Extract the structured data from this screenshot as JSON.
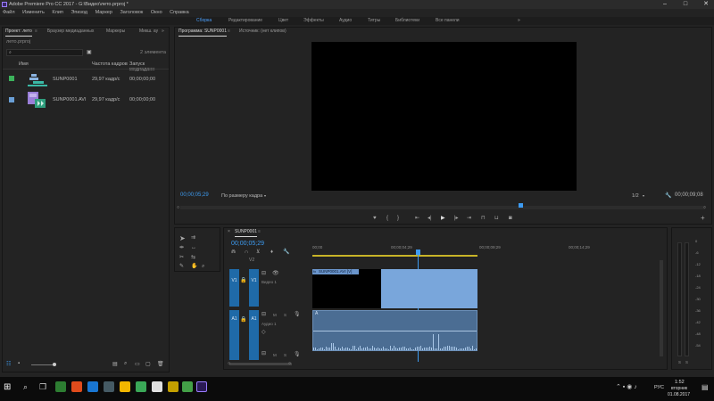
{
  "window": {
    "title": "Adobe Premiere Pro CC 2017 - G:\\Видео\\лето.prproj *",
    "min_icon": "minimize-icon",
    "max_icon": "maximize-icon",
    "close_icon": "close-icon"
  },
  "menu": [
    "Файл",
    "Изменить",
    "Клип",
    "Эпизод",
    "Маркер",
    "Заголовок",
    "Окно",
    "Справка"
  ],
  "workspaces": [
    "Сборка",
    "Редактирование",
    "Цвет",
    "Эффекты",
    "Аудио",
    "Титры",
    "Библиотеки",
    "Все панели"
  ],
  "project": {
    "tabs": [
      "Проект: лето",
      "Браузер медиаданных",
      "Маркеры",
      "Микш. ау"
    ],
    "file": "лето.prproj",
    "item_count": "2 элемента",
    "columns": [
      "Имя",
      "Частота кадров",
      "Запуск медиаданн"
    ],
    "items": [
      {
        "name": "SUNP0001",
        "fps": "29,97 кадр/с",
        "start": "00;00;00;00",
        "swatch": "#3cb35c"
      },
      {
        "name": "SUNP0001.AVI",
        "fps": "29,97 кадр/с",
        "start": "00;00;00;00",
        "swatch": "#6a9fd6"
      }
    ]
  },
  "program": {
    "tabs": [
      "Программа: SUNP0001",
      "Источник: (нет клипов)"
    ],
    "timecode_left": "00;00;05;29",
    "fit": "По размеру кадра",
    "quality": "1/2",
    "timecode_right": "00;00;09;08"
  },
  "timeline": {
    "sequence": "SUNP0001",
    "timecode": "00;00;05;29",
    "ruler": [
      "00;00",
      "00;00;04;29",
      "00;00;09;29",
      "00;00;14;29"
    ],
    "tracks": {
      "v1_src": "V1",
      "v1": "V1",
      "v1_name": "Видео 1",
      "a1_src": "A1",
      "a1": "A1",
      "a1_name": "Аудио 1",
      "v2": "V2"
    },
    "video_clip": "SUNP0001.AVI [V]",
    "audio_clip_marker": "A",
    "track_toggle_m": "M",
    "track_toggle_s": "S"
  },
  "meter": {
    "scale": [
      "0",
      "-6",
      "-12",
      "-18",
      "-24",
      "-30",
      "-36",
      "-42",
      "-48",
      "-54"
    ],
    "bottom": [
      "S",
      "S"
    ]
  },
  "taskbar": {
    "lang": "РУС",
    "time": "1:52",
    "day": "вторник",
    "date": "01.08.2017"
  },
  "colors": {
    "accent": "#3d9bf1",
    "clip_video": "#79a6db",
    "clip_audio": "#4b6d93",
    "track_header": "#1f6aa8"
  }
}
